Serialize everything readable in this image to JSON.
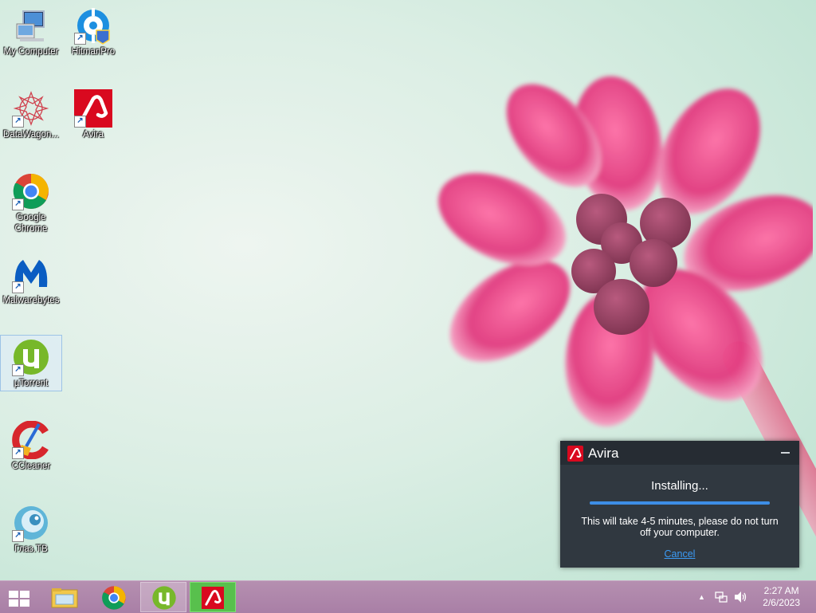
{
  "desktop_icons": [
    {
      "label": "My Computer",
      "icon": "computer-icon"
    },
    {
      "label": "HitmanPro",
      "icon": "hitmanpro-icon"
    },
    {
      "label": "DataWagon...",
      "icon": "datawagon-icon"
    },
    {
      "label": "Avira",
      "icon": "avira-icon"
    },
    {
      "label": "Google Chrome",
      "icon": "chrome-icon"
    },
    {
      "label": "Malwarebytes",
      "icon": "malwarebytes-icon"
    },
    {
      "label": "µTorrent",
      "icon": "utorrent-icon"
    },
    {
      "label": "CCleaner",
      "icon": "ccleaner-icon"
    },
    {
      "label": "Глаз.ТВ",
      "icon": "glaztv-icon"
    }
  ],
  "popup": {
    "title": "Avira",
    "status": "Installing...",
    "progress": 1.0,
    "message": "This will take 4-5 minutes, please do not turn off your computer.",
    "cancel_label": "Cancel"
  },
  "taskbar": {
    "pinned": [
      "start-icon",
      "file-explorer-icon",
      "chrome-icon",
      "utorrent-icon",
      "avira-icon"
    ],
    "clock": {
      "time": "2:27 AM",
      "date": "2/6/2023"
    }
  },
  "colors": {
    "avira_red": "#d9091f",
    "utorrent_green": "#77b82a",
    "popup_bg": "#303840",
    "link_blue": "#3b9bf5",
    "taskbar": "#b08aad"
  }
}
